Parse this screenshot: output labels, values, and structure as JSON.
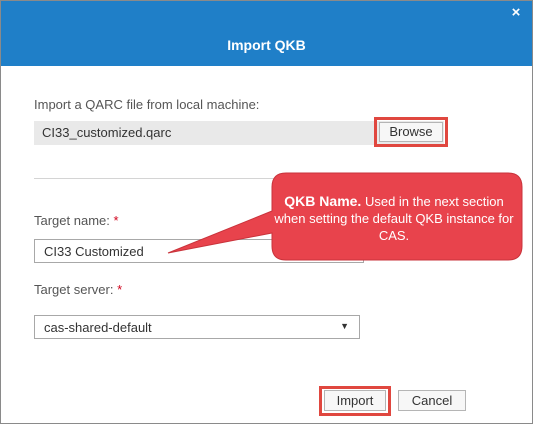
{
  "dialog": {
    "title": "Import QKB",
    "close_glyph": "×"
  },
  "file_section": {
    "label": "Import a QARC file from local machine:",
    "file_name": "CI33_customized.qarc",
    "browse_label": "Browse"
  },
  "target_name": {
    "label": "Target name:",
    "required_mark": "*",
    "value": "CI33 Customized"
  },
  "target_server": {
    "label": "Target server:",
    "required_mark": "*",
    "selected": "cas-shared-default"
  },
  "footer": {
    "import_label": "Import",
    "cancel_label": "Cancel"
  },
  "callout": {
    "heading": "QKB Name.",
    "body": "Used in the next section when setting the default QKB instance for CAS."
  },
  "colors": {
    "header_bg": "#1f7fc8",
    "highlight": "#e0473f",
    "callout_fill": "#e8434c",
    "required": "#d0021b"
  },
  "icons": {
    "close": "close-icon",
    "dropdown": "chevron-down-icon"
  }
}
